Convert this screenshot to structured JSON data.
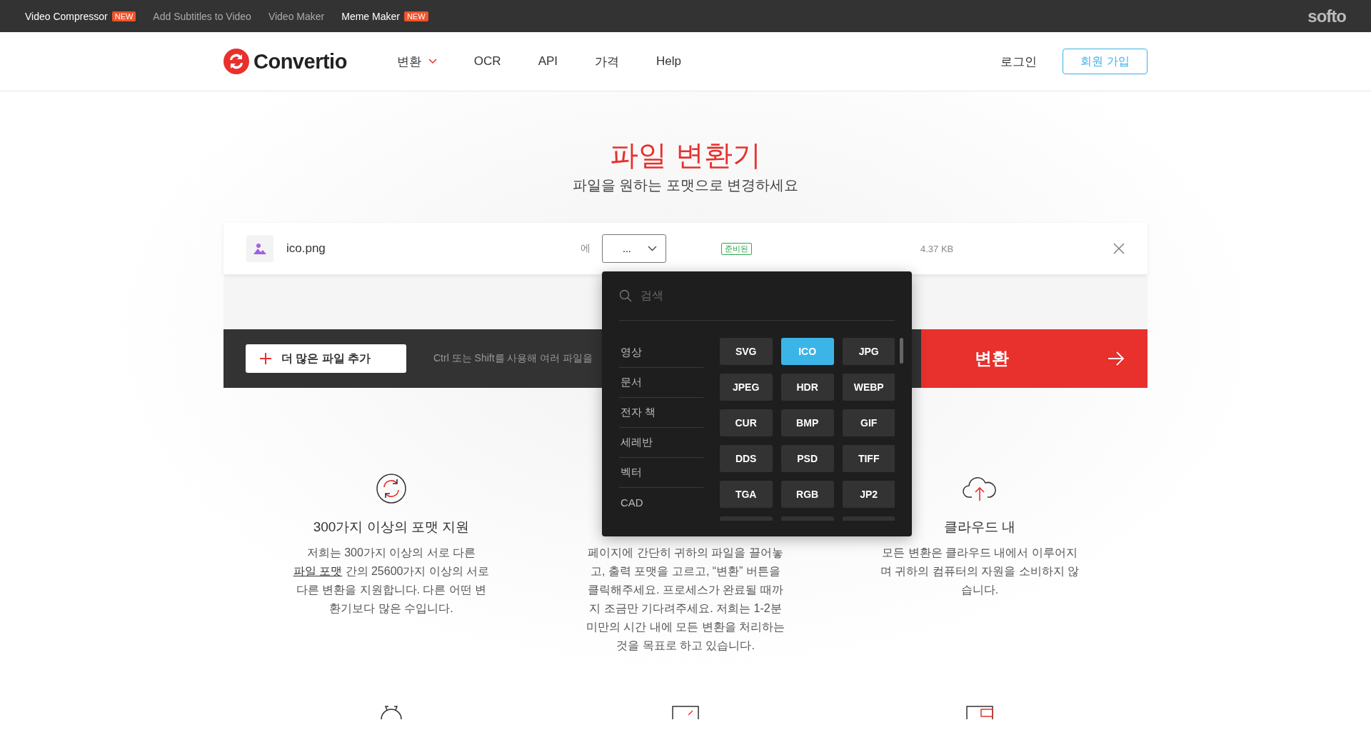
{
  "top_bar": {
    "links": [
      {
        "label": "Video Compressor",
        "badge": "NEW",
        "dim": false
      },
      {
        "label": "Add Subtitles to Video",
        "dim": true
      },
      {
        "label": "Video Maker",
        "dim": true
      },
      {
        "label": "Meme Maker",
        "badge": "NEW",
        "dim": false
      }
    ],
    "brand": "softo"
  },
  "header": {
    "logo": "Convertio",
    "nav": [
      {
        "label": "변환",
        "kind": "dropdown"
      },
      {
        "label": "OCR",
        "kind": "link"
      },
      {
        "label": "API",
        "kind": "link"
      },
      {
        "label": "가격",
        "kind": "link"
      },
      {
        "label": "Help",
        "kind": "link"
      }
    ],
    "login": "로그인",
    "signup": "회원 가입"
  },
  "hero": {
    "title": "파일 변환기",
    "subtitle": "파일을 원하는 포맷으로 변경하세요"
  },
  "file": {
    "name": "ico.png",
    "to_label": "에",
    "format_value": "...",
    "status": "준비된",
    "size": "4.37 KB"
  },
  "action_bar": {
    "add_button": "더 많은 파일 추가",
    "hint": "Ctrl 또는 Shift를 사용해 여러 파일을",
    "convert_button": "변환"
  },
  "format_menu": {
    "search": {
      "placeholder": "검색"
    },
    "categories": [
      "영상",
      "문서",
      "전자 책",
      "세레반",
      "벡터",
      "CAD"
    ],
    "formats": [
      {
        "label": "SVG",
        "selected": false
      },
      {
        "label": "ICO",
        "selected": true
      },
      {
        "label": "JPG",
        "selected": false
      },
      {
        "label": "JPEG",
        "selected": false
      },
      {
        "label": "HDR",
        "selected": false
      },
      {
        "label": "WEBP",
        "selected": false
      },
      {
        "label": "CUR",
        "selected": false
      },
      {
        "label": "BMP",
        "selected": false
      },
      {
        "label": "GIF",
        "selected": false
      },
      {
        "label": "DDS",
        "selected": false
      },
      {
        "label": "PSD",
        "selected": false
      },
      {
        "label": "TIFF",
        "selected": false
      },
      {
        "label": "TGA",
        "selected": false
      },
      {
        "label": "RGB",
        "selected": false
      },
      {
        "label": "JP2",
        "selected": false
      }
    ]
  },
  "features": [
    {
      "kind": "sync",
      "title": "300가지 이상의 포맷 지원",
      "text_before": "저희는 300가지 이상의 서로 다른 ",
      "link": "파일 포맷",
      "text_after": " 간의 25600가지 이상의 서로 다른 변환을 지원합니다. 다른 어떤 변환기보다 많은 수입니다."
    },
    {
      "kind": "plain",
      "text_before": "페이지에 간단히 귀하의 파일을 끌어놓고, 출력 포맷을 고르고, “변환” 버튼을 클릭해주세요. 프로세스가 완료될 때까지 조금만 기다려주세요. 저희는 1-2분 미만의 시간 내에 모든 변환을 처리하는 것을 목표로 하고 있습니다."
    },
    {
      "kind": "cloud",
      "title": "클라우드 내",
      "text_before": "모든 변환은 클라우드 내에서 이루어지며 귀하의 컴퓨터의 자원을 소비하지 않습니다."
    }
  ]
}
